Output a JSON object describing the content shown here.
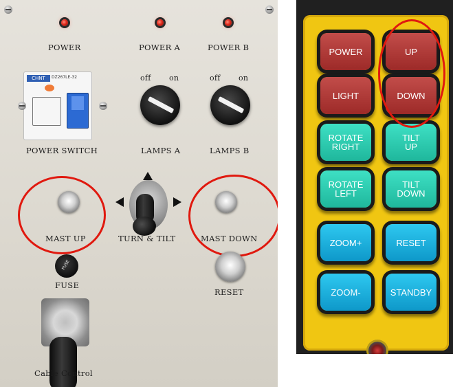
{
  "control_panel": {
    "indicator_labels": [
      "POWER",
      "POWER A",
      "POWER B"
    ],
    "power_switch_label": "POWER SWITCH",
    "breaker_brand": "CHNT",
    "breaker_model": "DZ267LE-32",
    "lamps_a": {
      "label": "LAMPS A",
      "off": "off",
      "on": "on"
    },
    "lamps_b": {
      "label": "LAMPS B",
      "off": "off",
      "on": "on"
    },
    "mast_up_label": "MAST UP",
    "turn_tilt_label": "TURN & TILT",
    "mast_down_label": "MAST DOWN",
    "fuse_label": "FUSE",
    "fuse_cap_text": "FUSE",
    "reset_label": "RESET",
    "cable_label": "Cable Control"
  },
  "remote": {
    "buttons": [
      {
        "label": "POWER",
        "color": "red"
      },
      {
        "label": "UP",
        "color": "red"
      },
      {
        "label": "LIGHT",
        "color": "red"
      },
      {
        "label": "DOWN",
        "color": "red"
      },
      {
        "label": "ROTATE\nRIGHT",
        "color": "green"
      },
      {
        "label": "TILT\nUP",
        "color": "green"
      },
      {
        "label": "ROTATE\nLEFT",
        "color": "green"
      },
      {
        "label": "TILT\nDOWN",
        "color": "green"
      },
      {
        "label": "ZOOM+",
        "color": "blue"
      },
      {
        "label": "RESET",
        "color": "blue"
      },
      {
        "label": "ZOOM-",
        "color": "blue"
      },
      {
        "label": "STANDBY",
        "color": "blue"
      }
    ]
  },
  "colors": {
    "highlight_circle": "#e0190f",
    "remote_body": "#f0c612",
    "button_red": "#b03b39",
    "button_green": "#2dcdb1",
    "button_blue": "#1eb4e2"
  }
}
